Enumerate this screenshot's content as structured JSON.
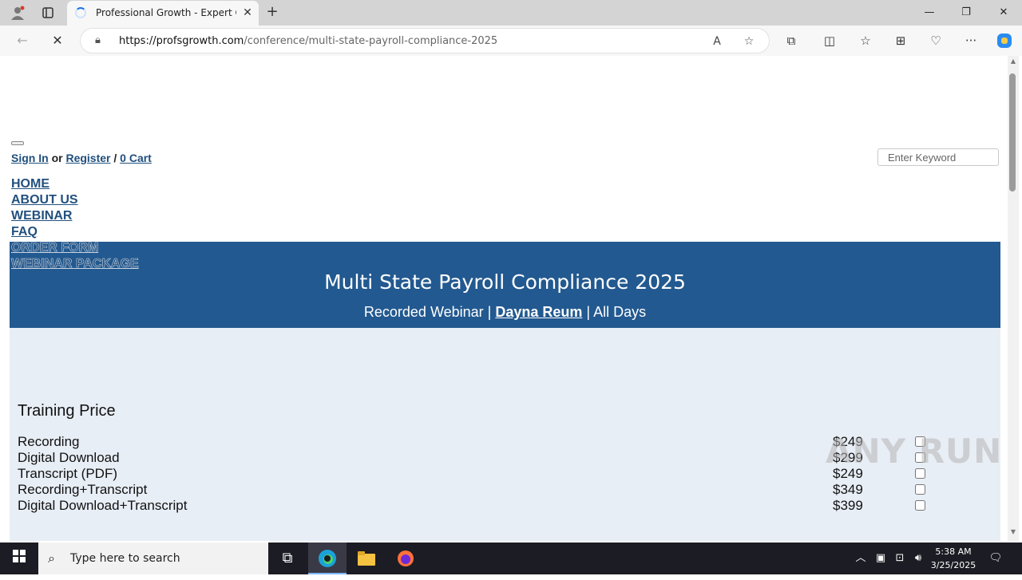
{
  "browser": {
    "tab_title": "Professional Growth - Expert Cor",
    "url_host": "https://profsgrowth.com",
    "url_path": "/conference/multi-state-payroll-compliance-2025",
    "icons": {
      "profile": "profile-icon",
      "tab_actions": "tab-actions-icon",
      "refresh": "stop-loading-icon",
      "read_aloud": "read-aloud-icon",
      "favorite": "star-icon",
      "extensions": "extensions-icon",
      "split": "split-screen-icon",
      "favorites": "favorites-icon",
      "collections": "collections-icon",
      "performance": "browser-essentials-icon",
      "more": "more-icon",
      "copilot": "copilot-icon"
    }
  },
  "page": {
    "auth": {
      "sign_in": "Sign In",
      "or": "or",
      "register": "Register",
      "slash": "/",
      "cart": "0 Cart"
    },
    "search": {
      "placeholder": "Enter Keyword"
    },
    "nav": [
      "HOME",
      "ABOUT US",
      "WEBINAR",
      "FAQ",
      "ORDER FORM",
      "WEBINAR PACKAGE"
    ],
    "hero": {
      "title": "Multi State Payroll Compliance 2025",
      "sub_prefix": "Recorded Webinar |",
      "speaker": "Dayna Reum",
      "sub_suffix": "| All Days"
    },
    "training": {
      "title": "Training Price",
      "options": [
        {
          "label": "Recording",
          "price": "$249",
          "checked": false
        },
        {
          "label": "Digital Download",
          "price": "$299",
          "checked": false
        },
        {
          "label": "Transcript (PDF)",
          "price": "$249",
          "checked": false
        },
        {
          "label": "Recording+Transcript",
          "price": "$349",
          "checked": false
        },
        {
          "label": "Digital Download+Transcript",
          "price": "$399",
          "checked": false
        }
      ]
    },
    "watermark": "ANY RUN"
  },
  "taskbar": {
    "search_placeholder": "Type here to search",
    "time": "5:38 AM",
    "date": "3/25/2025"
  },
  "colors": {
    "hero_bg": "#225990",
    "content_bg": "#e8eef6",
    "link": "#1f4f7e"
  }
}
